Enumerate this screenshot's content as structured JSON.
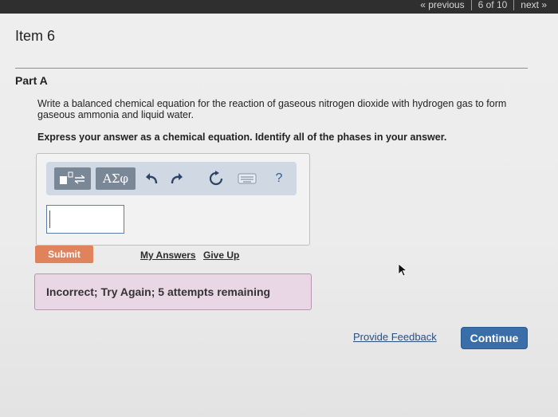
{
  "pager": {
    "previous_label": "« previous",
    "page_count": "6 of 10",
    "next_label": "next »"
  },
  "item": {
    "title": "Item 6"
  },
  "part": {
    "title": "Part A",
    "question": "Write a balanced chemical equation for the reaction of gaseous nitrogen dioxide with hydrogen gas to form gaseous ammonia and liquid water.",
    "instruction": "Express your answer as a chemical equation. Identify all of the phases in your answer."
  },
  "toolbar": {
    "symbols_label": "ΑΣφ",
    "help_label": "?",
    "icons": [
      "templates-icon",
      "undo-icon",
      "redo-icon",
      "reset-icon",
      "keyboard-icon",
      "help-icon"
    ]
  },
  "answer": {
    "value": ""
  },
  "actions": {
    "submit_label": "Submit",
    "my_answers_label": "My Answers",
    "give_up_label": "Give Up"
  },
  "feedback": {
    "message": "Incorrect; Try Again; 5 attempts remaining"
  },
  "footer": {
    "provide_feedback_label": "Provide Feedback",
    "continue_label": "Continue"
  },
  "colors": {
    "submit": "#e0835d",
    "continue": "#3a6ea8",
    "feedback_bg": "#ead7e6",
    "toolbar_bg": "#cfd8e3"
  }
}
